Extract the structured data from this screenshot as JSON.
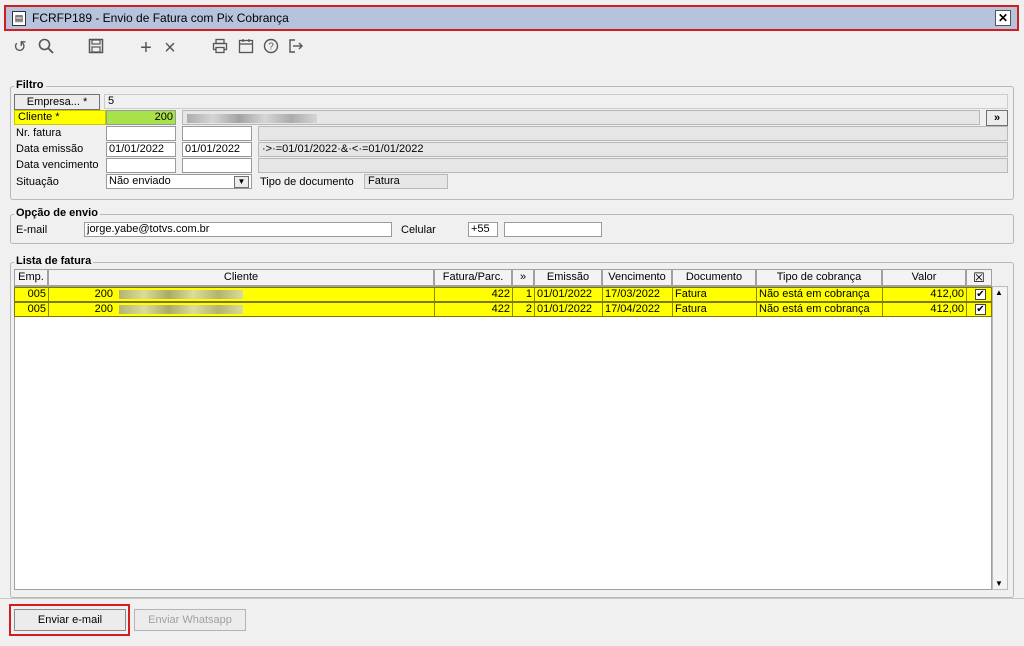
{
  "window": {
    "title": "FCRFP189 - Envio de Fatura com Pix Cobrança",
    "close": "✕"
  },
  "toolbar": {
    "undo": "↺",
    "search": "🔍",
    "save": "💾",
    "add": "+",
    "remove": "×",
    "print": "🖶",
    "calendar": "📅",
    "help": "?",
    "exit": "⇥"
  },
  "filtro": {
    "legend": "Filtro",
    "empresa_btn": "Empresa... *",
    "empresa_value": "5",
    "cliente_label": "Cliente *",
    "cliente_value": "200",
    "nr_fatura_label": "Nr. fatura",
    "data_emissao_label": "Data emissão",
    "data_emissao_from": "01/01/2022",
    "data_emissao_to": "01/01/2022",
    "data_emissao_expr": "·>·=01/01/2022·&·<·=01/01/2022",
    "data_vencimento_label": "Data vencimento",
    "situacao_label": "Situação",
    "situacao_value": "Não enviado",
    "tipo_doc_label": "Tipo de documento",
    "tipo_doc_value": "Fatura",
    "more_btn": "»"
  },
  "envio": {
    "legend": "Opção de envio",
    "email_label": "E-mail",
    "email_value": "jorge.yabe@totvs.com.br",
    "celular_label": "Celular",
    "ddi": "+55",
    "celular_value": ""
  },
  "lista": {
    "legend": "Lista de fatura",
    "columns": [
      "Emp.",
      "Cliente",
      "Fatura/Parc.",
      "»",
      "Emissão",
      "Vencimento",
      "Documento",
      "Tipo de cobrança",
      "Valor",
      "☒"
    ],
    "rows": [
      {
        "emp": "005",
        "cliente_cod": "200",
        "fatura": "422",
        "parc": "1",
        "emissao": "01/01/2022",
        "vencimento": "17/03/2022",
        "documento": "Fatura",
        "tipo": "Não está em cobrança",
        "valor": "412,00",
        "check": "✔"
      },
      {
        "emp": "005",
        "cliente_cod": "200",
        "fatura": "422",
        "parc": "2",
        "emissao": "01/01/2022",
        "vencimento": "17/04/2022",
        "documento": "Fatura",
        "tipo": "Não está em cobrança",
        "valor": "412,00",
        "check": "✔"
      }
    ]
  },
  "footer": {
    "email_btn": "Enviar e-mail",
    "whatsapp_btn": "Enviar Whatsapp"
  }
}
